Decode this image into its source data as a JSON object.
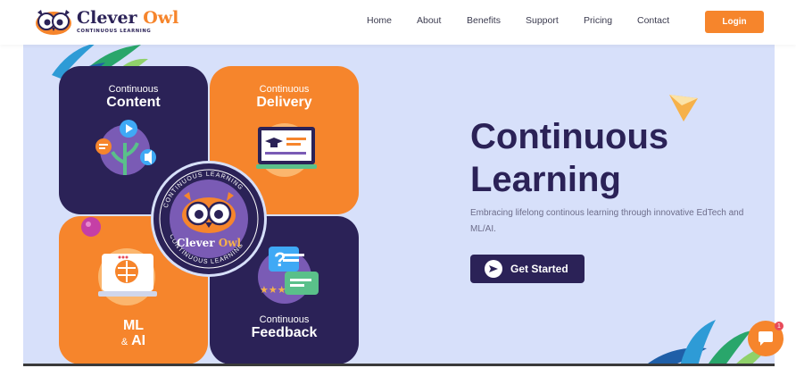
{
  "brand": {
    "name_part1": "Clever",
    "name_part2": "Owl",
    "tagline": "CONTINUOUS LEARNING"
  },
  "nav": {
    "links": [
      "Home",
      "About",
      "Benefits",
      "Support",
      "Pricing",
      "Contact"
    ],
    "login_label": "Login"
  },
  "hero": {
    "quadrants": [
      {
        "small": "Continuous",
        "big": "Content"
      },
      {
        "small": "Continuous",
        "big": "Delivery"
      },
      {
        "small": "&",
        "big": "ML",
        "big2": "AI"
      },
      {
        "small": "Continuous",
        "big": "Feedback"
      }
    ],
    "badge": {
      "ring_text": "CONTINUOUS LEARNING",
      "name_part1": "Clever",
      "name_part2": "Owl"
    },
    "title_line1": "Continuous",
    "title_line2": "Learning",
    "description": "Embracing lifelong continous learning through innovative EdTech and ML/AI.",
    "cta_label": "Get Started"
  },
  "chat": {
    "badge_count": "1"
  },
  "colors": {
    "navy": "#2b2257",
    "orange": "#f6852c",
    "hero_bg": "#d7e0fa",
    "purple": "#7a5bb5"
  }
}
